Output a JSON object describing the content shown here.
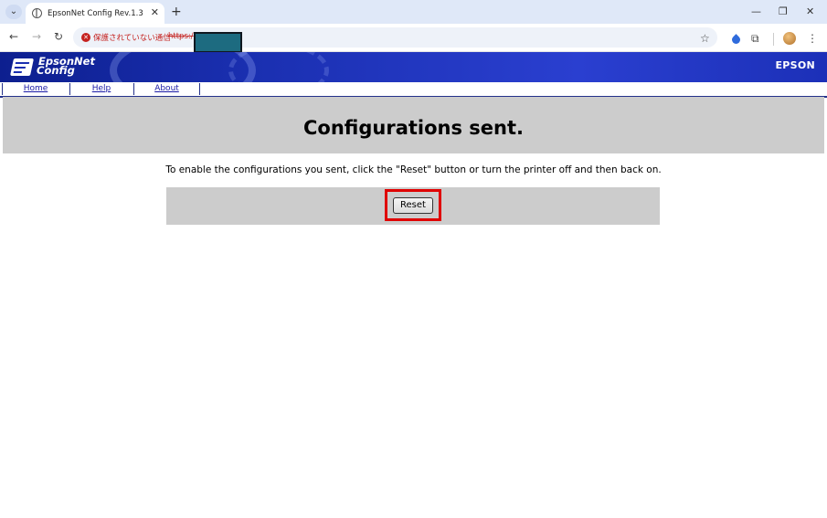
{
  "browser": {
    "tab_title": "EpsonNet Config Rev.1.3",
    "security_label": "保護されていない通信",
    "url_prefix": "https:/"
  },
  "banner": {
    "logo_line1": "EpsonNet",
    "logo_line2": "Config",
    "brand": "EPSON"
  },
  "menu": [
    {
      "label": "Home"
    },
    {
      "label": "Help"
    },
    {
      "label": "About"
    }
  ],
  "page": {
    "heading": "Configurations sent.",
    "notice": "To enable the configurations you sent, click the \"Reset\" button or turn the printer off and then back on.",
    "reset_label": "Reset"
  },
  "colors": {
    "banner_blue": "#1a2fb0",
    "band_gray": "#cccccc",
    "highlight_red": "#e00000",
    "link_blue": "#1a1aa6"
  }
}
